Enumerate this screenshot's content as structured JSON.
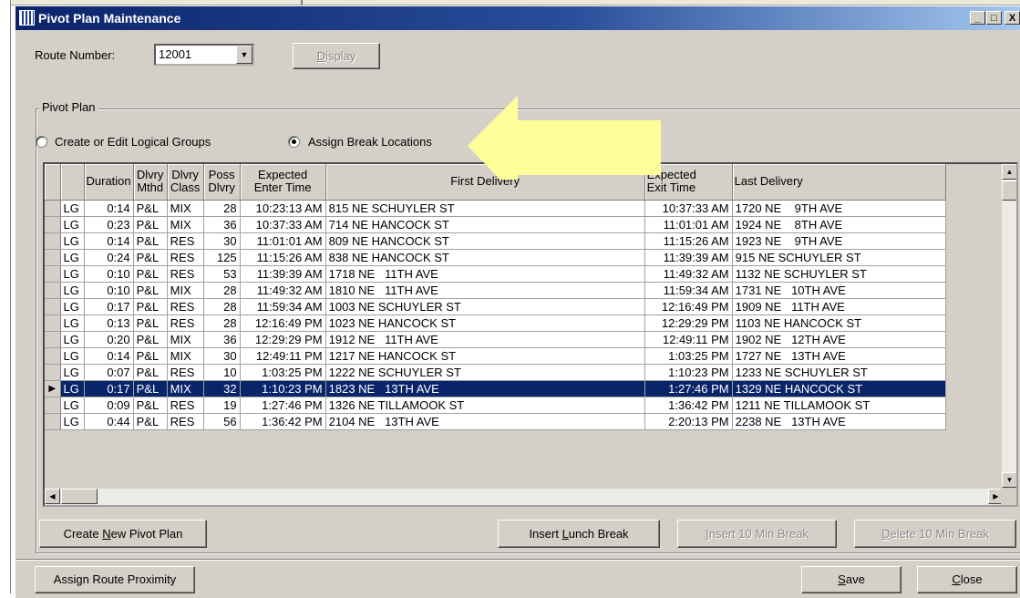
{
  "window": {
    "title": "Pivot Plan Maintenance"
  },
  "title_buttons": {
    "minimize": "_",
    "maximize": "□",
    "close": "X"
  },
  "route": {
    "label": "Route Number:",
    "value": "12001",
    "display_label_pre": "",
    "display_label_key": "D",
    "display_label_post": "isplay"
  },
  "pivot_plan": {
    "group_title": "Pivot Plan",
    "radio_create": "Create or Edit Logical Groups",
    "radio_assign": "Assign Break Locations",
    "selected_mode": "assign"
  },
  "grid": {
    "headers": {
      "duration": "Duration",
      "dlvry_mthd_1": "Dlvry",
      "dlvry_mthd_2": "Mthd",
      "dlvry_class_1": "Dlvry",
      "dlvry_class_2": "Class",
      "poss_dlvry_1": "Poss",
      "poss_dlvry_2": "Dlvry",
      "enter_time_1": "Expected",
      "enter_time_2": "Enter Time",
      "first_delivery": "First Delivery",
      "exit_time_1": "Expected",
      "exit_time_2": "Exit Time",
      "last_delivery": "Last Delivery"
    },
    "selected_row": 11,
    "rows": [
      [
        "LG",
        "0:14",
        "P&L",
        "MIX",
        "28",
        "10:23:13 AM",
        "815 NE SCHUYLER ST",
        "10:37:33 AM",
        "1720 NE    9TH AVE"
      ],
      [
        "LG",
        "0:23",
        "P&L",
        "MIX",
        "36",
        "10:37:33 AM",
        "714 NE HANCOCK ST",
        "11:01:01 AM",
        "1924 NE    8TH AVE"
      ],
      [
        "LG",
        "0:14",
        "P&L",
        "RES",
        "30",
        "11:01:01 AM",
        "809 NE HANCOCK ST",
        "11:15:26 AM",
        "1923 NE    9TH AVE"
      ],
      [
        "LG",
        "0:24",
        "P&L",
        "RES",
        "125",
        "11:15:26 AM",
        "838 NE HANCOCK ST",
        "11:39:39 AM",
        "915 NE SCHUYLER ST"
      ],
      [
        "LG",
        "0:10",
        "P&L",
        "RES",
        "53",
        "11:39:39 AM",
        "1718 NE   11TH AVE",
        "11:49:32 AM",
        "1132 NE SCHUYLER ST"
      ],
      [
        "LG",
        "0:10",
        "P&L",
        "MIX",
        "28",
        "11:49:32 AM",
        "1810 NE   11TH AVE",
        "11:59:34 AM",
        "1731 NE   10TH AVE"
      ],
      [
        "LG",
        "0:17",
        "P&L",
        "RES",
        "28",
        "11:59:34 AM",
        "1003 NE SCHUYLER ST",
        "12:16:49 PM",
        "1909 NE   11TH AVE"
      ],
      [
        "LG",
        "0:13",
        "P&L",
        "RES",
        "28",
        "12:16:49 PM",
        "1023 NE HANCOCK ST",
        "12:29:29 PM",
        "1103 NE HANCOCK ST"
      ],
      [
        "LG",
        "0:20",
        "P&L",
        "MIX",
        "36",
        "12:29:29 PM",
        "1912 NE   11TH AVE",
        "12:49:11 PM",
        "1902 NE   12TH AVE"
      ],
      [
        "LG",
        "0:14",
        "P&L",
        "MIX",
        "30",
        "12:49:11 PM",
        "1217 NE HANCOCK ST",
        "1:03:25 PM",
        "1727 NE   13TH AVE"
      ],
      [
        "LG",
        "0:07",
        "P&L",
        "RES",
        "10",
        "1:03:25 PM",
        "1222 NE SCHUYLER ST",
        "1:10:23 PM",
        "1233 NE SCHUYLER ST"
      ],
      [
        "LG",
        "0:17",
        "P&L",
        "MIX",
        "32",
        "1:10:23 PM",
        "1823 NE   13TH AVE",
        "1:27:46 PM",
        "1329 NE HANCOCK ST"
      ],
      [
        "LG",
        "0:09",
        "P&L",
        "RES",
        "19",
        "1:27:46 PM",
        "1326 NE TILLAMOOK ST",
        "1:36:42 PM",
        "1211 NE TILLAMOOK ST"
      ],
      [
        "LG",
        "0:44",
        "P&L",
        "RES",
        "56",
        "1:36:42 PM",
        "2104 NE   13TH AVE",
        "2:20:13 PM",
        "2238 NE   13TH AVE"
      ]
    ]
  },
  "buttons": {
    "create_pre": "Create ",
    "create_key": "N",
    "create_post": "ew Pivot Plan",
    "lunch_pre": "Insert ",
    "lunch_key": "L",
    "lunch_post": "unch Break",
    "ins10_pre": "",
    "ins10_key": "I",
    "ins10_post": "nsert 10 Min Break",
    "del10_pre": "",
    "del10_key": "D",
    "del10_post": "elete 10 Min Break",
    "proximity": "Assign Route Proximity",
    "save_pre": "",
    "save_key": "S",
    "save_post": "ave",
    "close_pre": "",
    "close_key": "C",
    "close_post": "lose"
  },
  "colors": {
    "selection": "#0a246a",
    "arrow": "#ffff99",
    "face": "#d4d0c8"
  }
}
